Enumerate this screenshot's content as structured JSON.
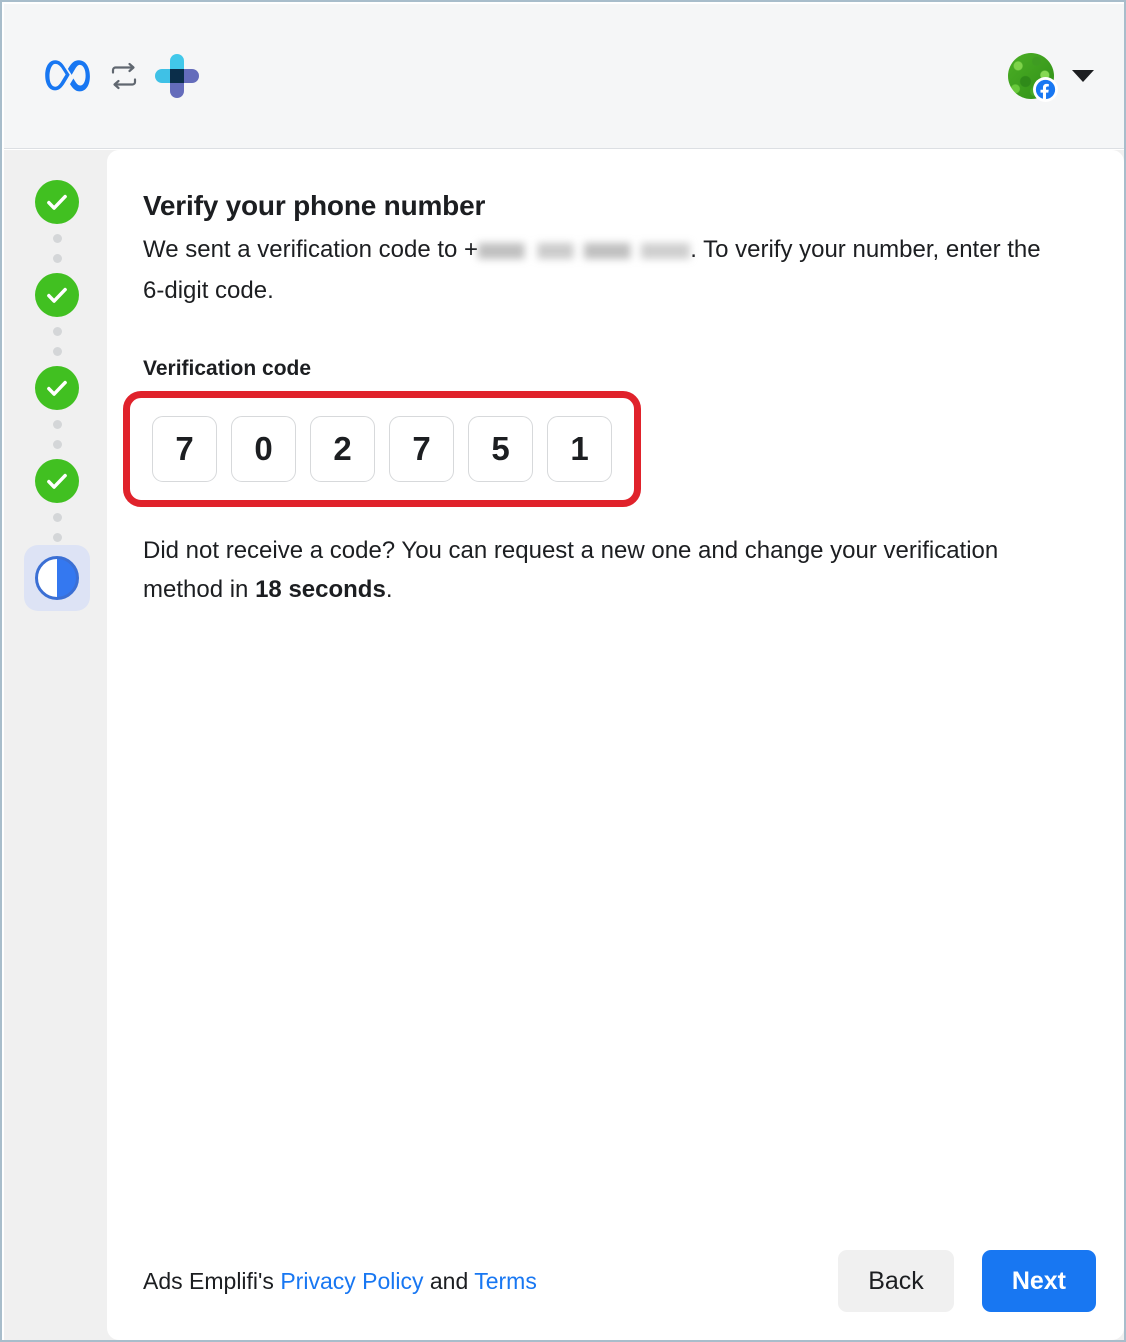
{
  "topbar": {
    "meta_logo": "meta-logo-icon",
    "sync_icon": "sync-arrows-icon",
    "emplifi_logo": "emplifi-logo-icon",
    "avatar": "user-avatar",
    "platform_badge": "facebook-badge-icon",
    "caret": "chevron-down-icon"
  },
  "stepper": {
    "completed_steps": 4,
    "completed_icon": "check-icon",
    "active_icon": "half-circle-progress-icon"
  },
  "main": {
    "title": "Verify your phone number",
    "subtitle_part1": "We sent a verification code to +",
    "phone_redacted": "XXX XXX XXX XXX",
    "subtitle_part2": ". To verify your number, enter the 6-digit code.",
    "field_label": "Verification code",
    "code_digits": [
      "7",
      "0",
      "2",
      "7",
      "5",
      "1"
    ],
    "highlight_color": "#e0222b",
    "resend_part1": "Did not receive a code? You can request a new one and change your verification method in ",
    "resend_countdown": "18 seconds",
    "resend_part2": "."
  },
  "footer": {
    "legal_prefix": "Ads Emplifi's ",
    "privacy_link": "Privacy Policy",
    "legal_middle": " and ",
    "terms_link": "Terms",
    "back_label": "Back",
    "next_label": "Next",
    "primary_color": "#1877f2"
  }
}
